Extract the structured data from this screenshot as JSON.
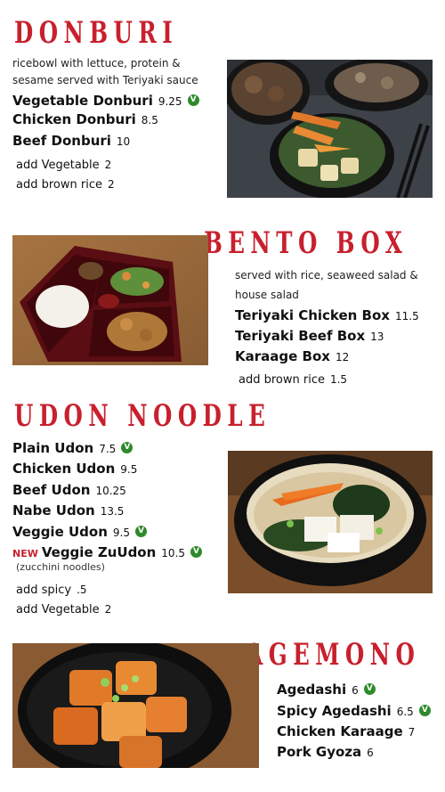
{
  "donburi": {
    "title": "DONBURI",
    "description": "ricebowl with lettuce, protein & sesame served with Teriyaki sauce",
    "items": [
      {
        "name": "Vegetable Donburi",
        "price": "9.25",
        "veg": "V"
      },
      {
        "name": "Chicken Donburi",
        "price": "8.5"
      },
      {
        "name": "Beef Donburi",
        "price": "10"
      }
    ],
    "addons": [
      {
        "name": "add Vegetable",
        "price": "2"
      },
      {
        "name": "add brown rice",
        "price": "2"
      }
    ]
  },
  "bento": {
    "title": "BENTO BOX",
    "description": "served with rice, seaweed salad & house salad",
    "items": [
      {
        "name": "Teriyaki Chicken Box",
        "price": "11.5"
      },
      {
        "name": "Teriyaki Beef Box",
        "price": "13"
      },
      {
        "name": "Karaage Box",
        "price": "12"
      }
    ],
    "addons": [
      {
        "name": "add brown rice",
        "price": "1.5"
      }
    ]
  },
  "udon": {
    "title": "UDON NOODLE",
    "items": [
      {
        "name": "Plain Udon",
        "price": "7.5",
        "veg": "V"
      },
      {
        "name": "Chicken Udon",
        "price": "9.5"
      },
      {
        "name": "Beef Udon",
        "price": "10.25"
      },
      {
        "name": "Nabe Udon",
        "price": "13.5"
      },
      {
        "name": "Veggie Udon",
        "price": "9.5",
        "veg": "V"
      },
      {
        "name": "Veggie ZuUdon",
        "price": "10.5",
        "veg": "V",
        "tag": "NEW",
        "note": "(zucchini noodles)"
      }
    ],
    "addons": [
      {
        "name": "add spicy",
        "price": ".5"
      },
      {
        "name": "add Vegetable",
        "price": "2"
      }
    ]
  },
  "agemono": {
    "title": "AGEMONO",
    "items": [
      {
        "name": "Agedashi",
        "price": "6",
        "veg": "V"
      },
      {
        "name": "Spicy Agedashi",
        "price": "6.5",
        "veg": "V"
      },
      {
        "name": "Chicken Karaage",
        "price": "7"
      },
      {
        "name": "Pork Gyoza",
        "price": "6"
      }
    ]
  },
  "colors": {
    "title_red": "#c8202d",
    "veg_green": "#2f8a2b"
  }
}
